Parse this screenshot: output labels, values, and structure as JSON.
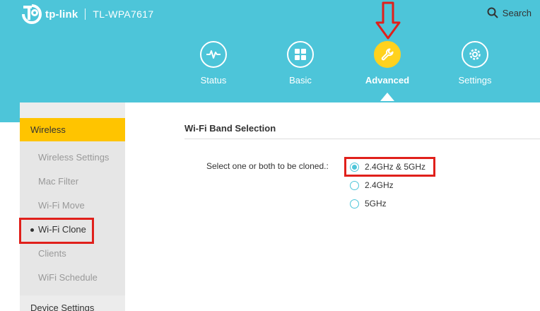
{
  "header": {
    "brand": "tp-link",
    "model": "TL-WPA7617",
    "search_label": "Search"
  },
  "nav": {
    "items": [
      {
        "label": "Status",
        "icon": "status-pulse-icon"
      },
      {
        "label": "Basic",
        "icon": "grid-icon"
      },
      {
        "label": "Advanced",
        "icon": "wrench-icon",
        "active": true
      },
      {
        "label": "Settings",
        "icon": "gear-icon"
      }
    ]
  },
  "sidebar": {
    "active_section": "Wireless",
    "items": [
      {
        "label": "Wireless Settings"
      },
      {
        "label": "Mac Filter"
      },
      {
        "label": "Wi-Fi Move"
      },
      {
        "label": "Wi-Fi Clone",
        "active": true
      },
      {
        "label": "Clients"
      },
      {
        "label": "WiFi Schedule"
      }
    ],
    "next_section": "Device Settings"
  },
  "content": {
    "section_title": "Wi-Fi Band Selection",
    "field_label": "Select one or both to be cloned.:",
    "options": [
      {
        "label": "2.4GHz & 5GHz",
        "checked": true
      },
      {
        "label": "2.4GHz",
        "checked": false
      },
      {
        "label": "5GHz",
        "checked": false
      }
    ]
  },
  "colors": {
    "header_bg": "#4dc5d9",
    "accent_yellow": "#ffc400",
    "highlight_red": "#e0201b"
  }
}
